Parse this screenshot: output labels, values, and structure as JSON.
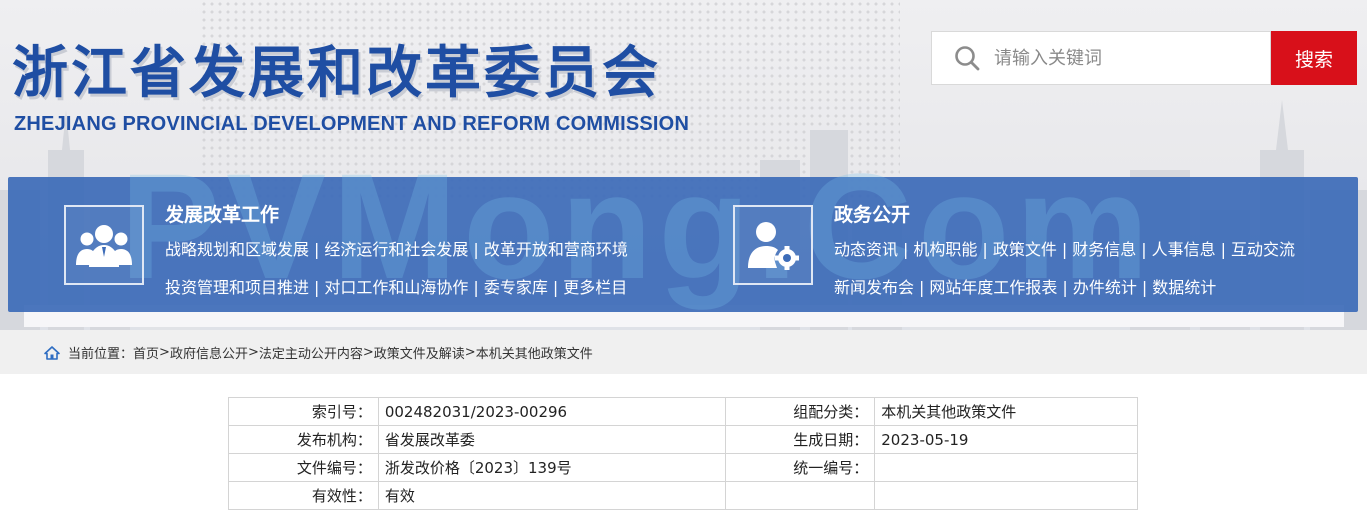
{
  "header": {
    "title": "浙江省发展和改革委员会",
    "subtitle": "ZHEJIANG PROVINCIAL DEVELOPMENT AND REFORM COMMISSION"
  },
  "search": {
    "placeholder": "请输入关键词",
    "button": "搜索"
  },
  "watermark": "PVMong.Com",
  "nav": {
    "left": {
      "title": "发展改革工作",
      "row1": [
        "战略规划和区域发展",
        "经济运行和社会发展",
        "改革开放和营商环境"
      ],
      "row2": [
        "投资管理和项目推进",
        "对口工作和山海协作",
        "委专家库",
        "更多栏目"
      ]
    },
    "right": {
      "title": "政务公开",
      "row1": [
        "动态资讯",
        "机构职能",
        "政策文件",
        "财务信息",
        "人事信息",
        "互动交流"
      ],
      "row2": [
        "新闻发布会",
        "网站年度工作报表",
        "办件统计",
        "数据统计"
      ]
    },
    "separator": "|"
  },
  "breadcrumb": {
    "prefix": "当前位置：",
    "items": [
      "首页",
      "政府信息公开",
      "法定主动公开内容",
      "政策文件及解读",
      "本机关其他政策文件"
    ],
    "sep": ">"
  },
  "info": {
    "rows": [
      {
        "l1": "索引号：",
        "v1": "002482031/2023-00296",
        "l2": "组配分类：",
        "v2": "本机关其他政策文件"
      },
      {
        "l1": "发布机构：",
        "v1": "省发展改革委",
        "l2": "生成日期：",
        "v2": "2023-05-19"
      },
      {
        "l1": "文件编号：",
        "v1": "浙发改价格〔2023〕139号",
        "l2": "统一编号：",
        "v2": ""
      },
      {
        "l1": "有效性：",
        "v1": "有效",
        "l2": "",
        "v2": ""
      }
    ]
  },
  "colors": {
    "brand_blue": "#1f4ea3",
    "nav_blue": "#3d6cb8",
    "search_red": "#d8101a"
  }
}
